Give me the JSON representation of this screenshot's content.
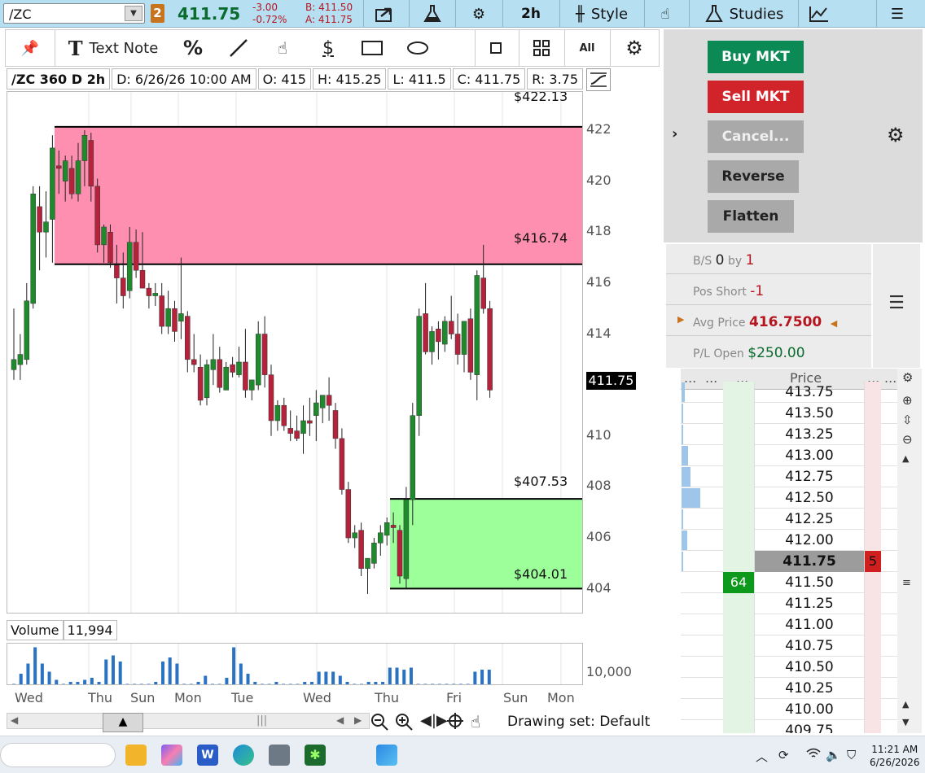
{
  "toolbar": {
    "symbol": "/ZC",
    "link_badge": "2",
    "last_price": "411.75",
    "change": "-3.00",
    "change_pct": "-0.72%",
    "bid": "B: 411.50",
    "ask": "A: 411.75",
    "timeframe": "2h",
    "style_label": "Style",
    "studies_label": "Studies"
  },
  "drawing_toolbar": {
    "text_note_label": "Text Note",
    "percent_label": "%",
    "dollar_label": "$",
    "all_label": "All"
  },
  "chart_header": {
    "symbol_period": "/ZC 360 D 2h",
    "date": "D: 6/26/26 10:00 AM",
    "open": "O: 415",
    "high": "H: 415.25",
    "low": "L: 411.5",
    "close": "C: 411.75",
    "range": "R: 3.75"
  },
  "zones": {
    "supply_top": "$422.13",
    "supply_bottom": "$416.74",
    "demand_top": "$407.53",
    "demand_bottom": "$404.01",
    "supply_color": "#ff8fb0",
    "demand_color": "#9cff9a"
  },
  "current_price_tag": "411.75",
  "volume": {
    "label": "Volume",
    "value": "11,994",
    "axis_label": "10,000"
  },
  "x_axis_labels": [
    "Wed",
    "Thu",
    "Sun",
    "Mon",
    "Tue",
    "Wed",
    "Thu",
    "Fri",
    "Sun",
    "Mon"
  ],
  "drawing_set": "Drawing set: Default",
  "order_buttons": {
    "buy": "Buy MKT",
    "sell": "Sell MKT",
    "cancel": "Cancel...",
    "reverse": "Reverse",
    "flatten": "Flatten"
  },
  "position": {
    "bs_label": "B/S",
    "bs_value": "0",
    "by_label": "by",
    "by_value": "1",
    "pos_label": "Pos Short",
    "pos_value": "-1",
    "avg_label": "Avg Price",
    "avg_value": "416.7500",
    "pl_label": "P/L Open",
    "pl_value": "$250.00"
  },
  "ladder": {
    "header_dots": "...",
    "price_header": "Price",
    "rows": [
      {
        "price": "413.75",
        "vol": 0.15
      },
      {
        "price": "413.50",
        "vol": 0.1
      },
      {
        "price": "413.25",
        "vol": 0.1
      },
      {
        "price": "413.00",
        "vol": 0.35
      },
      {
        "price": "412.75",
        "vol": 0.45
      },
      {
        "price": "412.50",
        "vol": 0.95
      },
      {
        "price": "412.25",
        "vol": 0.1
      },
      {
        "price": "412.00",
        "vol": 0.3
      },
      {
        "price": "411.75",
        "vol": 0.1,
        "current": true,
        "ask_size": "5"
      },
      {
        "price": "411.50",
        "vol": 0,
        "bid_size": "64"
      },
      {
        "price": "411.25",
        "vol": 0
      },
      {
        "price": "411.00",
        "vol": 0
      },
      {
        "price": "410.75",
        "vol": 0
      },
      {
        "price": "410.50",
        "vol": 0
      },
      {
        "price": "410.25",
        "vol": 0
      },
      {
        "price": "410.00",
        "vol": 0
      },
      {
        "price": "409.75",
        "vol": 0
      }
    ]
  },
  "taskbar": {
    "time": "11:21 AM",
    "date": "6/26/2026"
  },
  "chart_data": {
    "type": "candlestick",
    "y_ticks": [
      "422",
      "420",
      "418",
      "416",
      "414",
      "412",
      "410",
      "408",
      "406",
      "404"
    ],
    "ylim": [
      403,
      423.5
    ],
    "candles": [
      {
        "o": 412.6,
        "h": 415.0,
        "l": 412.2,
        "c": 413.0
      },
      {
        "o": 412.8,
        "h": 414.0,
        "l": 412.2,
        "c": 413.2
      },
      {
        "o": 413.0,
        "h": 416.0,
        "l": 412.8,
        "c": 415.3
      },
      {
        "o": 415.2,
        "h": 419.8,
        "l": 415.0,
        "c": 419.5
      },
      {
        "o": 419.0,
        "h": 419.8,
        "l": 416.5,
        "c": 418.0
      },
      {
        "o": 418.0,
        "h": 419.6,
        "l": 417.0,
        "c": 418.4
      },
      {
        "o": 418.5,
        "h": 421.8,
        "l": 416.8,
        "c": 421.3
      },
      {
        "o": 420.6,
        "h": 421.2,
        "l": 419.5,
        "c": 420.5
      },
      {
        "o": 420.0,
        "h": 421.0,
        "l": 419.2,
        "c": 420.8
      },
      {
        "o": 420.5,
        "h": 421.0,
        "l": 419.3,
        "c": 419.5
      },
      {
        "o": 419.5,
        "h": 421.5,
        "l": 419.2,
        "c": 420.8
      },
      {
        "o": 420.8,
        "h": 422.0,
        "l": 419.8,
        "c": 421.8
      },
      {
        "o": 421.6,
        "h": 421.9,
        "l": 419.2,
        "c": 419.8
      },
      {
        "o": 419.8,
        "h": 420.1,
        "l": 417.2,
        "c": 417.5
      },
      {
        "o": 417.5,
        "h": 418.3,
        "l": 416.8,
        "c": 418.2
      },
      {
        "o": 418.0,
        "h": 418.3,
        "l": 416.6,
        "c": 416.8
      },
      {
        "o": 416.7,
        "h": 417.5,
        "l": 415.2,
        "c": 416.2
      },
      {
        "o": 416.2,
        "h": 417.2,
        "l": 415.0,
        "c": 415.5
      },
      {
        "o": 415.7,
        "h": 418.2,
        "l": 415.4,
        "c": 417.6
      },
      {
        "o": 417.6,
        "h": 418.1,
        "l": 416.2,
        "c": 416.5
      },
      {
        "o": 416.5,
        "h": 418.0,
        "l": 415.8,
        "c": 415.8
      },
      {
        "o": 415.8,
        "h": 416.0,
        "l": 415.0,
        "c": 415.5
      },
      {
        "o": 415.5,
        "h": 416.0,
        "l": 415.1,
        "c": 415.6
      },
      {
        "o": 415.5,
        "h": 416.0,
        "l": 414.0,
        "c": 414.3
      },
      {
        "o": 414.3,
        "h": 415.7,
        "l": 414.0,
        "c": 415.0
      },
      {
        "o": 415.0,
        "h": 415.3,
        "l": 413.7,
        "c": 414.1
      },
      {
        "o": 414.5,
        "h": 417.0,
        "l": 413.8,
        "c": 414.8
      },
      {
        "o": 414.7,
        "h": 414.9,
        "l": 412.5,
        "c": 413.0
      },
      {
        "o": 413.0,
        "h": 414.0,
        "l": 412.5,
        "c": 412.8
      },
      {
        "o": 412.7,
        "h": 413.2,
        "l": 411.2,
        "c": 411.4
      },
      {
        "o": 411.5,
        "h": 413.0,
        "l": 411.2,
        "c": 412.8
      },
      {
        "o": 412.6,
        "h": 414.0,
        "l": 412.0,
        "c": 413.0
      },
      {
        "o": 413.0,
        "h": 413.5,
        "l": 411.7,
        "c": 411.9
      },
      {
        "o": 411.8,
        "h": 412.9,
        "l": 411.8,
        "c": 412.7
      },
      {
        "o": 412.8,
        "h": 413.1,
        "l": 412.3,
        "c": 412.5
      },
      {
        "o": 412.4,
        "h": 413.5,
        "l": 412.3,
        "c": 412.9
      },
      {
        "o": 412.9,
        "h": 414.2,
        "l": 411.5,
        "c": 411.8
      },
      {
        "o": 411.8,
        "h": 412.2,
        "l": 411.4,
        "c": 412.2
      },
      {
        "o": 412.0,
        "h": 414.5,
        "l": 411.8,
        "c": 414.0
      },
      {
        "o": 414.0,
        "h": 414.7,
        "l": 411.9,
        "c": 412.4
      },
      {
        "o": 412.4,
        "h": 412.8,
        "l": 410.0,
        "c": 410.6
      },
      {
        "o": 410.6,
        "h": 411.4,
        "l": 410.2,
        "c": 411.2
      },
      {
        "o": 411.2,
        "h": 411.5,
        "l": 410.2,
        "c": 410.4
      },
      {
        "o": 410.3,
        "h": 411.0,
        "l": 409.8,
        "c": 410.1
      },
      {
        "o": 410.2,
        "h": 410.8,
        "l": 409.8,
        "c": 409.9
      },
      {
        "o": 410.1,
        "h": 411.2,
        "l": 409.3,
        "c": 410.6
      },
      {
        "o": 410.6,
        "h": 411.5,
        "l": 410.0,
        "c": 410.5
      },
      {
        "o": 410.8,
        "h": 411.8,
        "l": 409.8,
        "c": 411.3
      },
      {
        "o": 411.1,
        "h": 411.6,
        "l": 410.5,
        "c": 411.6
      },
      {
        "o": 411.6,
        "h": 412.3,
        "l": 410.6,
        "c": 411.2
      },
      {
        "o": 411.0,
        "h": 411.3,
        "l": 409.5,
        "c": 409.9
      },
      {
        "o": 409.9,
        "h": 410.3,
        "l": 407.7,
        "c": 407.9
      },
      {
        "o": 407.9,
        "h": 408.2,
        "l": 405.8,
        "c": 406.0
      },
      {
        "o": 406.0,
        "h": 406.5,
        "l": 405.6,
        "c": 406.2
      },
      {
        "o": 406.3,
        "h": 406.6,
        "l": 404.5,
        "c": 404.8
      },
      {
        "o": 404.8,
        "h": 405.1,
        "l": 403.8,
        "c": 405.2
      },
      {
        "o": 405.0,
        "h": 406.0,
        "l": 404.8,
        "c": 405.8
      },
      {
        "o": 405.8,
        "h": 406.5,
        "l": 405.3,
        "c": 406.2
      },
      {
        "o": 406.1,
        "h": 406.8,
        "l": 405.7,
        "c": 406.6
      },
      {
        "o": 406.5,
        "h": 407.0,
        "l": 405.8,
        "c": 406.4
      },
      {
        "o": 406.3,
        "h": 406.5,
        "l": 404.2,
        "c": 404.5
      },
      {
        "o": 404.4,
        "h": 408.0,
        "l": 404.0,
        "c": 407.5
      },
      {
        "o": 407.5,
        "h": 411.3,
        "l": 406.5,
        "c": 410.8
      },
      {
        "o": 410.8,
        "h": 415.0,
        "l": 410.0,
        "c": 414.7
      },
      {
        "o": 414.8,
        "h": 416.0,
        "l": 413.2,
        "c": 413.3
      },
      {
        "o": 413.3,
        "h": 414.3,
        "l": 412.8,
        "c": 414.1
      },
      {
        "o": 414.2,
        "h": 414.5,
        "l": 413.0,
        "c": 413.7
      },
      {
        "o": 413.6,
        "h": 414.7,
        "l": 413.3,
        "c": 414.5
      },
      {
        "o": 414.5,
        "h": 415.5,
        "l": 413.8,
        "c": 414.0
      },
      {
        "o": 414.0,
        "h": 414.8,
        "l": 412.8,
        "c": 413.2
      },
      {
        "o": 413.2,
        "h": 414.5,
        "l": 412.5,
        "c": 414.5
      },
      {
        "o": 414.6,
        "h": 415.0,
        "l": 412.2,
        "c": 412.5
      },
      {
        "o": 412.4,
        "h": 416.5,
        "l": 411.4,
        "c": 416.3
      },
      {
        "o": 416.2,
        "h": 417.5,
        "l": 414.8,
        "c": 415.0
      },
      {
        "o": 415.0,
        "h": 415.3,
        "l": 411.5,
        "c": 411.8
      }
    ],
    "volumes": [
      0.05,
      0.3,
      0.55,
      0.95,
      0.55,
      0.35,
      0.15,
      0.05,
      0.1,
      0.1,
      0.15,
      0.2,
      0.1,
      0.65,
      0.75,
      0.6,
      0.05,
      0.05,
      0.05,
      0.05,
      0.1,
      0.6,
      0.7,
      0.55,
      0.05,
      0.05,
      0.1,
      0.25,
      0.05,
      0.05,
      0.2,
      0.95,
      0.55,
      0.3,
      0.1,
      0.05,
      0.05,
      0.1,
      0.05,
      0.05,
      0.05,
      0.1,
      0.1,
      0.35,
      0.35,
      0.35,
      0.25,
      0.1,
      0.05,
      0.05,
      0.1,
      0.1,
      0.1,
      0.45,
      0.45,
      0.4,
      0.45,
      0.05,
      0.05,
      0.05,
      0.05,
      0.05,
      0.05,
      0.05,
      0.05,
      0.35,
      0.4,
      0.4
    ]
  }
}
